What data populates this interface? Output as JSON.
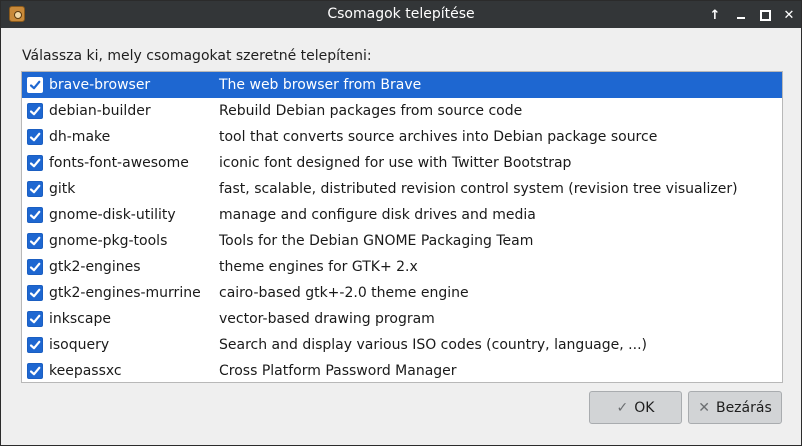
{
  "window": {
    "title": "Csomagok telepítése",
    "controls": {
      "up": "↑",
      "minimize": "",
      "maximize": "",
      "close": "✕"
    }
  },
  "prompt": "Válassza ki, mely csomagokat szeretné telepíteni:",
  "packages": [
    {
      "name": "brave-browser",
      "description": "The web browser from Brave",
      "checked": true,
      "selected": true
    },
    {
      "name": "debian-builder",
      "description": "Rebuild Debian packages from source code",
      "checked": true,
      "selected": false
    },
    {
      "name": "dh-make",
      "description": "tool that converts source archives into Debian package source",
      "checked": true,
      "selected": false
    },
    {
      "name": "fonts-font-awesome",
      "description": "iconic font designed for use with Twitter Bootstrap",
      "checked": true,
      "selected": false
    },
    {
      "name": "gitk",
      "description": "fast, scalable, distributed revision control system (revision tree visualizer)",
      "checked": true,
      "selected": false
    },
    {
      "name": "gnome-disk-utility",
      "description": "manage and configure disk drives and media",
      "checked": true,
      "selected": false
    },
    {
      "name": "gnome-pkg-tools",
      "description": "Tools for the Debian GNOME Packaging Team",
      "checked": true,
      "selected": false
    },
    {
      "name": "gtk2-engines",
      "description": "theme engines for GTK+ 2.x",
      "checked": true,
      "selected": false
    },
    {
      "name": "gtk2-engines-murrine",
      "description": "cairo-based gtk+-2.0 theme engine",
      "checked": true,
      "selected": false
    },
    {
      "name": "inkscape",
      "description": "vector-based drawing program",
      "checked": true,
      "selected": false
    },
    {
      "name": "isoquery",
      "description": "Search and display various ISO codes (country, language, ...)",
      "checked": true,
      "selected": false
    },
    {
      "name": "keepassxc",
      "description": "Cross Platform Password Manager",
      "checked": true,
      "selected": false
    }
  ],
  "buttons": {
    "ok_label": "OK",
    "ok_icon": "check-icon",
    "close_label": "Bezárás",
    "close_icon": "close-x-icon"
  },
  "colors": {
    "selection": "#1e67d1",
    "titlebar": "#333638",
    "window_bg": "#efefef"
  }
}
